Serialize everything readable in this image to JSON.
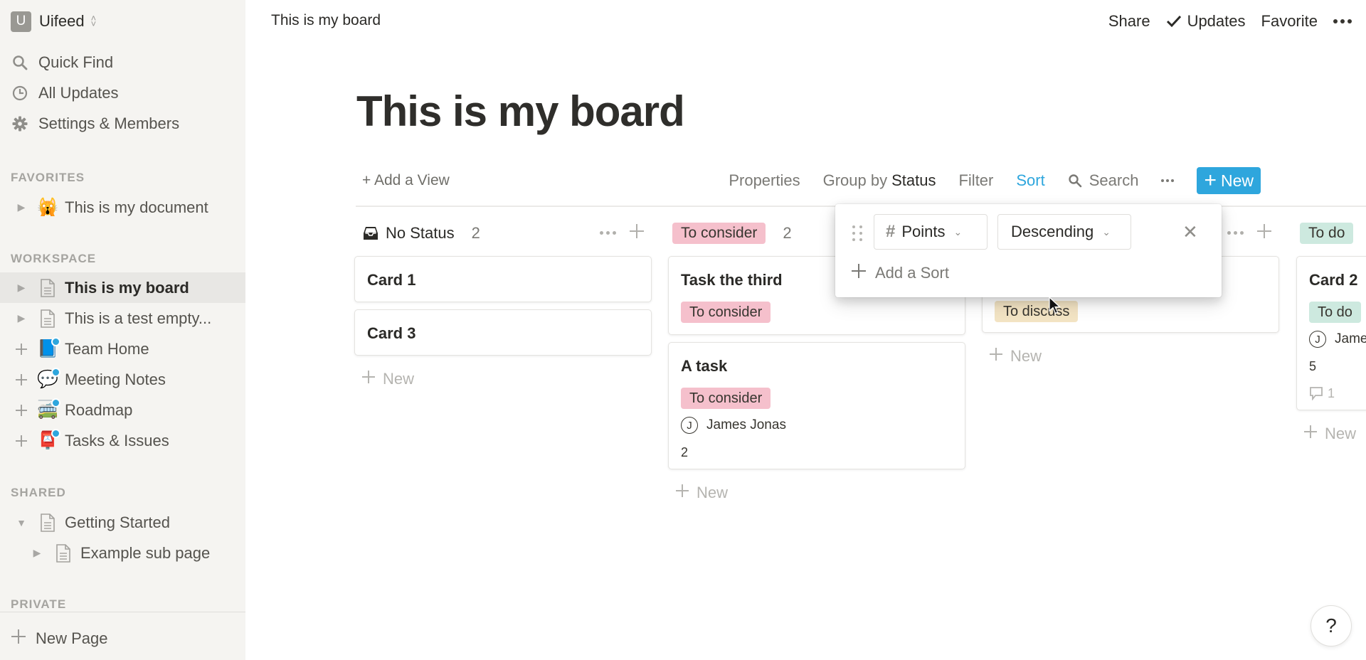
{
  "workspace": {
    "initial": "U",
    "name": "Uifeed"
  },
  "sidebar": {
    "nav": [
      {
        "icon": "search-icon",
        "label": "Quick Find"
      },
      {
        "icon": "clock-icon",
        "label": "All Updates"
      },
      {
        "icon": "gear-icon",
        "label": "Settings & Members"
      }
    ],
    "sections": {
      "favorites": "FAVORITES",
      "workspace": "WORKSPACE",
      "shared": "SHARED",
      "private": "PRIVATE"
    },
    "favorites": [
      {
        "icon": "scared-cat-emoji",
        "emoji": "🙀",
        "label": "This is my document"
      }
    ],
    "workspace_items": [
      {
        "icon": "page-icon",
        "label": "This is my board",
        "active": true
      },
      {
        "icon": "page-icon",
        "label": "This is a test empty..."
      },
      {
        "icon": "book-emoji",
        "emoji": "📘",
        "label": "Team Home"
      },
      {
        "icon": "speech-bubble-emoji",
        "emoji": "💬",
        "label": "Meeting Notes"
      },
      {
        "icon": "bus-emoji",
        "emoji": "🚎",
        "label": "Roadmap"
      },
      {
        "icon": "mailbox-emoji",
        "emoji": "📮",
        "label": "Tasks & Issues"
      }
    ],
    "shared_items": [
      {
        "icon": "page-icon",
        "label": "Getting Started",
        "expanded": true
      },
      {
        "icon": "page-icon",
        "label": "Example sub page"
      }
    ],
    "new_page": "New Page"
  },
  "topbar": {
    "title": "This is my board",
    "share": "Share",
    "updates": "Updates",
    "favorite": "Favorite"
  },
  "page": {
    "title": "This is my board"
  },
  "viewbar": {
    "add_view": "+ Add a View",
    "properties": "Properties",
    "group_by_prefix": "Group by",
    "group_by_value": "Status",
    "filter": "Filter",
    "sort": "Sort",
    "search": "Search",
    "new": "New"
  },
  "board": {
    "new_label": "New",
    "columns": [
      {
        "name": "No Status",
        "count": "2",
        "cards": [
          {
            "title": "Card 1"
          },
          {
            "title": "Card 3"
          }
        ]
      },
      {
        "name": "To consider",
        "count": "2",
        "color": "#f5c0cc",
        "cards": [
          {
            "title": "Task the third",
            "tag": "To consider"
          },
          {
            "title": "A task",
            "tag": "To consider",
            "person": "James Jonas",
            "person_initial": "J",
            "points": "2"
          }
        ]
      },
      {
        "name": "",
        "count": "",
        "cards": [
          {
            "tag": "To discuss",
            "tag_color": "#f3e4c4"
          }
        ]
      },
      {
        "name": "To do",
        "count": "",
        "color": "#cde9df",
        "cards": [
          {
            "title": "Card 2",
            "tag": "To do",
            "person": "Jame",
            "person_initial": "J",
            "points": "5",
            "comments": "1"
          }
        ]
      }
    ]
  },
  "sort_popup": {
    "property": "Points",
    "direction": "Descending",
    "add_sort": "Add a Sort"
  },
  "help": "?",
  "colors": {
    "accent": "#2ea6dd",
    "to_consider": "#f5c0cc",
    "to_discuss": "#f3e4c4",
    "to_do": "#cde9df"
  }
}
